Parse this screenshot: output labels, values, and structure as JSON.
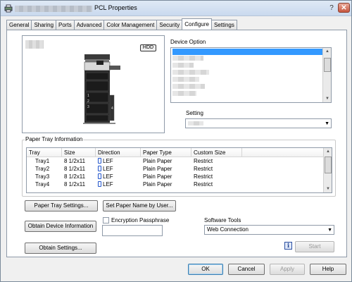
{
  "window": {
    "title": "PCL Properties"
  },
  "tabs": [
    {
      "label": "General"
    },
    {
      "label": "Sharing"
    },
    {
      "label": "Ports"
    },
    {
      "label": "Advanced"
    },
    {
      "label": "Color Management"
    },
    {
      "label": "Security"
    },
    {
      "label": "Configure",
      "active": true
    },
    {
      "label": "Settings"
    }
  ],
  "preview": {
    "badge": "HDD"
  },
  "device_option": {
    "label": "Device Option",
    "setting_label": "Setting"
  },
  "paper_tray": {
    "group_label": "Paper Tray Information",
    "columns": [
      "Tray",
      "Size",
      "Direction",
      "Paper Type",
      "Custom Size"
    ],
    "rows": [
      {
        "tray": "Tray1",
        "size": "8 1/2x11",
        "direction": "LEF",
        "type": "Plain Paper",
        "custom": "Restrict"
      },
      {
        "tray": "Tray2",
        "size": "8 1/2x11",
        "direction": "LEF",
        "type": "Plain Paper",
        "custom": "Restrict"
      },
      {
        "tray": "Tray3",
        "size": "8 1/2x11",
        "direction": "LEF",
        "type": "Plain Paper",
        "custom": "Restrict"
      },
      {
        "tray": "Tray4",
        "size": "8 1/2x11",
        "direction": "LEF",
        "type": "Plain Paper",
        "custom": "Restrict"
      }
    ]
  },
  "buttons": {
    "paper_tray_settings": "Paper Tray Settings...",
    "set_paper_name": "Set Paper Name by User...",
    "obtain_device_info": "Obtain Device Information",
    "obtain_settings": "Obtain Settings...",
    "start": "Start",
    "ok": "OK",
    "cancel": "Cancel",
    "apply": "Apply",
    "help": "Help"
  },
  "encryption": {
    "label": "Encryption Passphrase",
    "checked": false
  },
  "software_tools": {
    "label": "Software Tools",
    "selected": "Web Connection"
  },
  "icons": {
    "app": "printer-app-icon",
    "info": "info-icon",
    "close": "close-icon",
    "help": "help-icon"
  },
  "colors": {
    "selection": "#3399ff",
    "title_bar": "#c9d9ee"
  }
}
